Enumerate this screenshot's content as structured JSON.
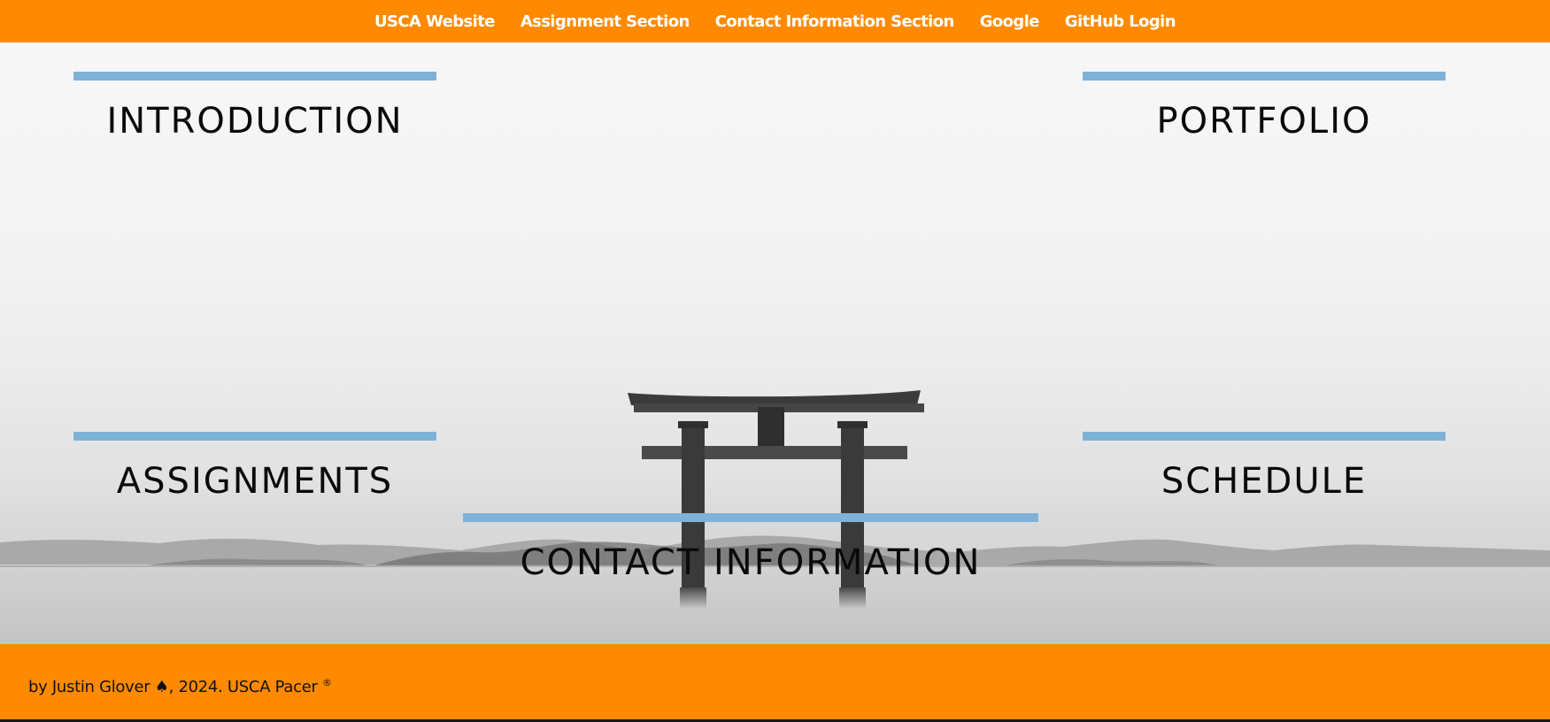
{
  "nav": {
    "links": [
      {
        "label": "USCA Website"
      },
      {
        "label": "Assignment Section"
      },
      {
        "label": "Contact Information Section"
      },
      {
        "label": "Google"
      },
      {
        "label": "GitHub Login"
      }
    ]
  },
  "sections": {
    "introduction": "INTRODUCTION",
    "portfolio": "PORTFOLIO",
    "assignments": "ASSIGNMENTS",
    "schedule": "SCHEDULE",
    "contact": "CONTACT INFORMATION"
  },
  "footer": {
    "credit": "by Justin Glover ♠, 2024. USCA Pacer",
    "registered": "®"
  },
  "colors": {
    "nav_bg": "#ff8a00",
    "footer_bg": "#ff8a00",
    "accent_bar": "#7fb2d8"
  }
}
